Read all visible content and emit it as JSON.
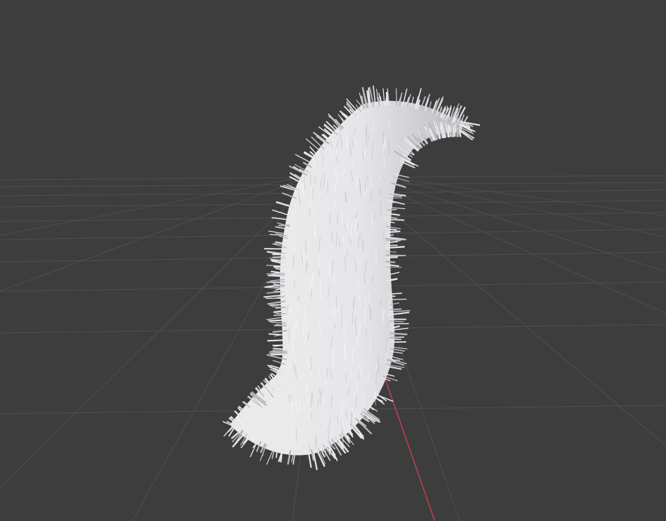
{
  "viewport": {
    "background_color": "#3d3d3d",
    "grid_line_color": "#4f4f4f",
    "x_axis_color": "#c0404f",
    "object": {
      "name": "fur-tail",
      "fur_color": "#e6e6e9",
      "shade_color": "#b9b9be"
    }
  }
}
